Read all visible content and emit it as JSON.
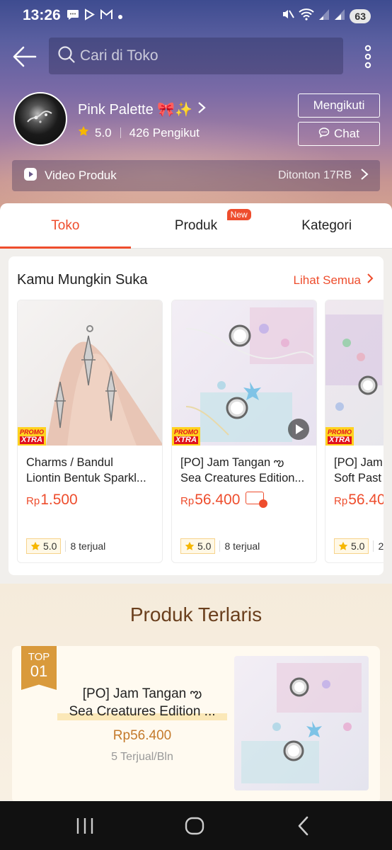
{
  "status_bar": {
    "time": "13:26",
    "battery": "63"
  },
  "search": {
    "placeholder": "Cari di Toko"
  },
  "shop": {
    "name": "Pink Palette 🎀✨",
    "rating": "5.0",
    "followers": "426 Pengikut",
    "follow_label": "Mengikuti",
    "chat_label": "Chat"
  },
  "video": {
    "label": "Video Produk",
    "views": "Ditonton 17RB"
  },
  "tabs": [
    {
      "label": "Toko",
      "active": true
    },
    {
      "label": "Produk",
      "badge": "New"
    },
    {
      "label": "Kategori"
    }
  ],
  "recommend": {
    "title": "Kamu Mungkin Suka",
    "see_all": "Lihat Semua",
    "items": [
      {
        "name1": "Charms / Bandul",
        "name2": "Liontin Bentuk Sparkl...",
        "currency": "Rp",
        "price": "1.500",
        "rating": "5.0",
        "sold": "8 terjual",
        "promo": "PROMO",
        "promo2": "XTRA"
      },
      {
        "name1": "[PO] Jam Tangan ఌ",
        "name2": "Sea Creatures Edition...",
        "currency": "Rp",
        "price": "56.400",
        "rating": "5.0",
        "sold": "8 terjual",
        "promo": "PROMO",
        "promo2": "XTRA"
      },
      {
        "name1": "[PO] Jam",
        "name2": "Soft Past",
        "currency": "Rp",
        "price": "56.40",
        "rating": "5.0",
        "sold": "2",
        "promo": "PROMO",
        "promo2": "XTRA"
      }
    ]
  },
  "bestseller": {
    "heading": "Produk Terlaris",
    "badge_top": "TOP",
    "badge_rank": "01",
    "name1": "[PO] Jam Tangan ఌ",
    "name2": "Sea Creatures Edition ...",
    "price": "Rp56.400",
    "sold": "5 Terjual/Bln"
  },
  "colors": {
    "accent": "#ee4d2d",
    "gold": "#d99a3c"
  }
}
